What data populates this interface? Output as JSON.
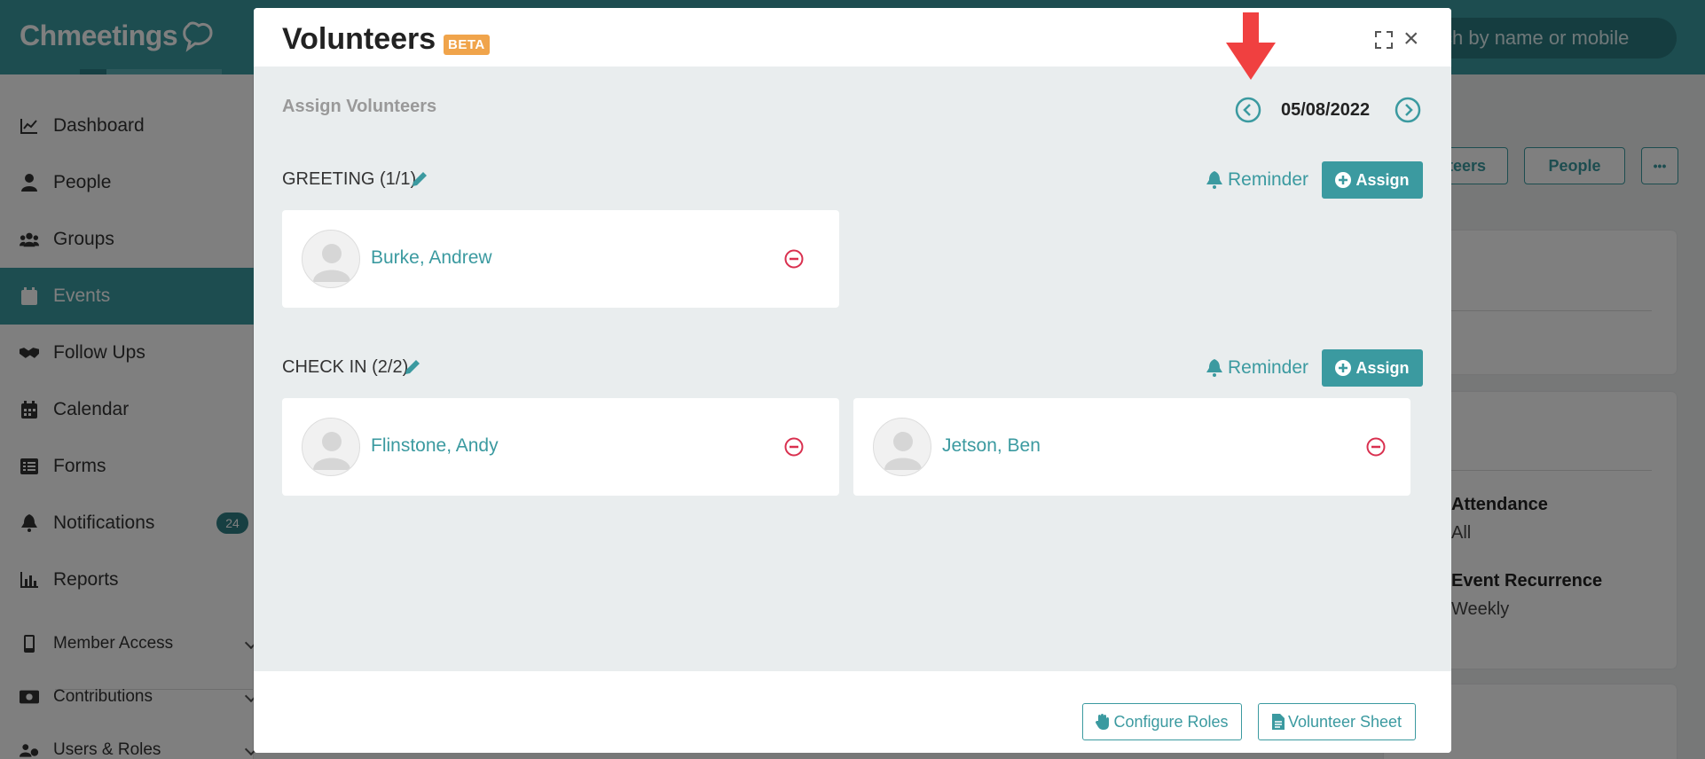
{
  "app": {
    "logo_text": "Chmeetings",
    "search_placeholder": "ch by name or mobile"
  },
  "sidebar": {
    "items": [
      {
        "label": "Dashboard",
        "icon": "chart-line-icon"
      },
      {
        "label": "People",
        "icon": "person-icon"
      },
      {
        "label": "Groups",
        "icon": "users-icon"
      },
      {
        "label": "Events",
        "icon": "calendar-icon",
        "active": true
      },
      {
        "label": "Follow Ups",
        "icon": "handshake-icon"
      },
      {
        "label": "Calendar",
        "icon": "calendar-grid-icon"
      },
      {
        "label": "Forms",
        "icon": "list-icon"
      },
      {
        "label": "Notifications",
        "icon": "bell-icon",
        "badge": "24"
      },
      {
        "label": "Reports",
        "icon": "bar-chart-icon"
      },
      {
        "label": "Member Access",
        "icon": "mobile-icon"
      },
      {
        "label": "Contributions",
        "icon": "money-icon"
      },
      {
        "label": "Users & Roles",
        "icon": "users-gear-icon"
      }
    ]
  },
  "background": {
    "volunteers_btn": "nteers",
    "people_btn": "People",
    "more_btn": "•••",
    "attendance_label": "Attendance",
    "attendance_value": "All",
    "recurrence_label": "Event Recurrence",
    "recurrence_value": "Weekly"
  },
  "modal": {
    "title": "Volunteers",
    "badge": "BETA",
    "section_title": "Assign Volunteers",
    "date": "05/08/2022",
    "roles": [
      {
        "title": "GREETING (1/1)",
        "reminder_label": "Reminder",
        "assign_label": "Assign",
        "volunteers": [
          "Burke, Andrew"
        ]
      },
      {
        "title": "CHECK IN (2/2)",
        "reminder_label": "Reminder",
        "assign_label": "Assign",
        "volunteers": [
          "Flinstone, Andy",
          "Jetson, Ben"
        ]
      }
    ],
    "footer": {
      "configure_roles": "Configure Roles",
      "volunteer_sheet": "Volunteer Sheet"
    }
  },
  "colors": {
    "teal": "#3b9aa0",
    "beta": "#f0a44b",
    "remove": "#d9304f",
    "arrow": "#f04040"
  }
}
